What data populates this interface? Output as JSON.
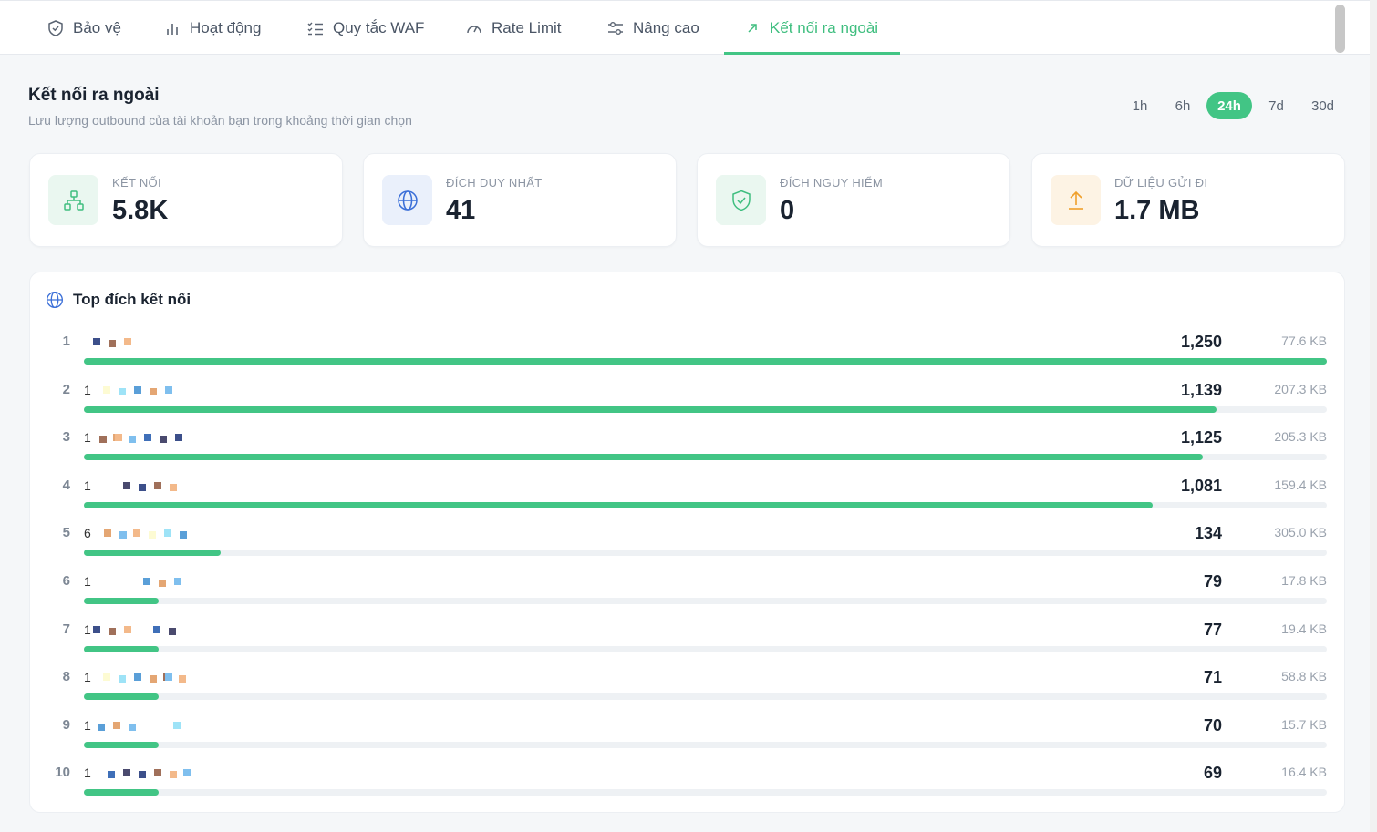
{
  "tabs": [
    {
      "label": "Bảo vệ",
      "icon": "shield-check-icon",
      "active": false
    },
    {
      "label": "Hoạt động",
      "icon": "bar-chart-icon",
      "active": false
    },
    {
      "label": "Quy tắc WAF",
      "icon": "list-check-icon",
      "active": false
    },
    {
      "label": "Rate Limit",
      "icon": "gauge-icon",
      "active": false
    },
    {
      "label": "Nâng cao",
      "icon": "sliders-icon",
      "active": false
    },
    {
      "label": "Kết nối ra ngoài",
      "icon": "arrow-up-right-icon",
      "active": true
    }
  ],
  "header": {
    "title": "Kết nối ra ngoài",
    "subtitle": "Lưu lượng outbound của tài khoản bạn trong khoảng thời gian chọn"
  },
  "time_ranges": [
    "1h",
    "6h",
    "24h",
    "7d",
    "30d"
  ],
  "selected_range": "24h",
  "stats": [
    {
      "label": "KẾT NỐI",
      "value": "5.8K",
      "icon": "network-icon",
      "color": "#3fbe7f",
      "bg": "#eaf7f0"
    },
    {
      "label": "ĐÍCH DUY NHẤT",
      "value": "41",
      "icon": "globe-icon",
      "color": "#3b6fd8",
      "bg": "#eaf0fb"
    },
    {
      "label": "ĐÍCH NGUY HIỂM",
      "value": "0",
      "icon": "shield-check-icon",
      "color": "#3fbe7f",
      "bg": "#eaf7f0"
    },
    {
      "label": "DỮ LIỆU GỬI ĐI",
      "value": "1.7 MB",
      "icon": "upload-icon",
      "color": "#f0a02b",
      "bg": "#fdf3e4"
    }
  ],
  "top_panel": {
    "title": "Top đích kết nối",
    "icon": "globe-icon"
  },
  "destinations": [
    {
      "rank": "1",
      "host_prefix": "",
      "count": "1,250",
      "size": "77.6 KB",
      "share": 1.0
    },
    {
      "rank": "2",
      "host_prefix": "1",
      "count": "1,139",
      "size": "207.3 KB",
      "share": 0.911
    },
    {
      "rank": "3",
      "host_prefix": "1",
      "count": "1,125",
      "size": "205.3 KB",
      "share": 0.9
    },
    {
      "rank": "4",
      "host_prefix": "1",
      "count": "1,081",
      "size": "159.4 KB",
      "share": 0.86
    },
    {
      "rank": "5",
      "host_prefix": "6",
      "count": "134",
      "size": "305.0 KB",
      "share": 0.11
    },
    {
      "rank": "6",
      "host_prefix": "1",
      "count": "79",
      "size": "17.8 KB",
      "share": 0.06
    },
    {
      "rank": "7",
      "host_prefix": "1",
      "count": "77",
      "size": "19.4 KB",
      "share": 0.06
    },
    {
      "rank": "8",
      "host_prefix": "1",
      "count": "71",
      "size": "58.8 KB",
      "share": 0.06
    },
    {
      "rank": "9",
      "host_prefix": "1",
      "count": "70",
      "size": "15.7 KB",
      "share": 0.06
    },
    {
      "rank": "10",
      "host_prefix": "1",
      "count": "69",
      "size": "16.4 KB",
      "share": 0.06
    }
  ]
}
